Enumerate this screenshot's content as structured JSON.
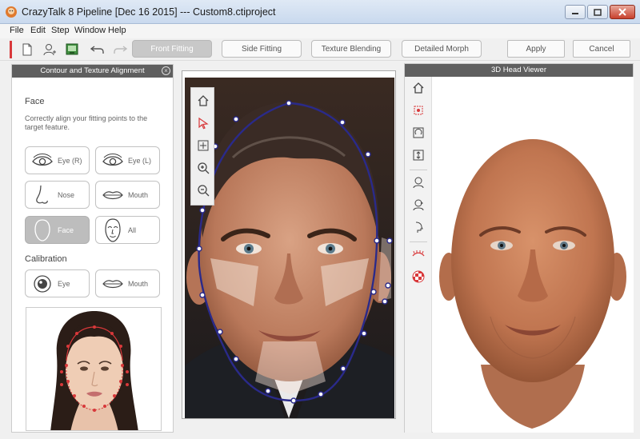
{
  "window": {
    "title": "CrazyTalk 8 Pipeline [Dec 16 2015] --- Custom8.ctiproject"
  },
  "menu": [
    "File",
    "Edit",
    "Step",
    "Window",
    "Help"
  ],
  "toolbar": {
    "tabs": [
      {
        "label": "Front Fitting",
        "active": true
      },
      {
        "label": "Side Fitting",
        "active": false
      },
      {
        "label": "Texture Blending",
        "active": false
      },
      {
        "label": "Detailed Morph",
        "active": false
      }
    ],
    "apply_label": "Apply",
    "cancel_label": "Cancel"
  },
  "left_panel": {
    "header": "Contour and Texture Alignment",
    "face_section": {
      "title": "Face",
      "description": "Correctly align your fitting points to the target feature.",
      "buttons": [
        {
          "label": "Eye (R)",
          "icon": "eye-icon",
          "selected": false
        },
        {
          "label": "Eye (L)",
          "icon": "eye-icon",
          "selected": false
        },
        {
          "label": "Nose",
          "icon": "nose-icon",
          "selected": false
        },
        {
          "label": "Mouth",
          "icon": "mouth-icon",
          "selected": false
        },
        {
          "label": "Face",
          "icon": "face-outline-icon",
          "selected": true
        },
        {
          "label": "All",
          "icon": "face-all-icon",
          "selected": false
        }
      ]
    },
    "calibration_section": {
      "title": "Calibration",
      "buttons": [
        {
          "label": "Eye",
          "icon": "eyeball-icon"
        },
        {
          "label": "Mouth",
          "icon": "mouth-icon"
        }
      ]
    }
  },
  "viewport_tools": [
    "home-icon",
    "select-arrow-icon",
    "move-icon",
    "zoom-in-icon",
    "zoom-out-icon"
  ],
  "right_panel": {
    "header": "3D Head Viewer",
    "tools": [
      "home-icon",
      "pick-icon",
      "rotate-icon",
      "scale-icon",
      "head-front-icon",
      "head-side-icon",
      "head-profile-icon",
      "eyelash-icon",
      "checker-icon"
    ]
  },
  "colors": {
    "accent_red": "#d8383a",
    "panel_header": "#5f5f5f",
    "contour_line": "#2a2a8a"
  }
}
